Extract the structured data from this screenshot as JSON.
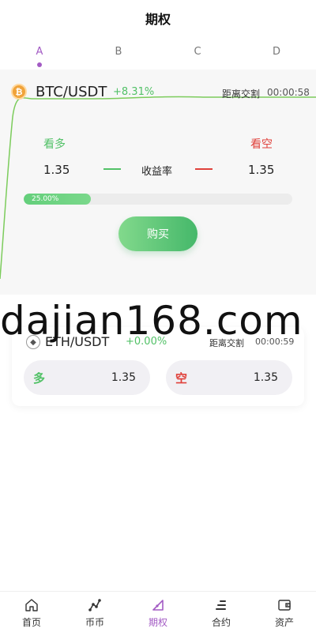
{
  "header": {
    "title": "期权"
  },
  "tabs": [
    {
      "label": "A",
      "active": true
    },
    {
      "label": "B",
      "active": false
    },
    {
      "label": "C",
      "active": false
    },
    {
      "label": "D",
      "active": false
    }
  ],
  "card1": {
    "icon": "bitcoin-icon",
    "pair": "BTC/USDT",
    "change": "+8.31%",
    "delivery_label": "距离交割",
    "delivery_time": "00:00:58",
    "long_label": "看多",
    "short_label": "看空",
    "long_value": "1.35",
    "short_value": "1.35",
    "rate_label": "收益率",
    "progress_text": "25.00%",
    "progress": 0.25,
    "buy_label": "购买"
  },
  "watermark": "dajian168.com",
  "card2": {
    "icon": "ethereum-icon",
    "pair": "ETH/USDT",
    "change": "+0.00%",
    "delivery_label": "距离交割",
    "delivery_time": "00:00:59",
    "long_key": "多",
    "long_value": "1.35",
    "short_key": "空",
    "short_value": "1.35"
  },
  "tabbar": [
    {
      "label": "首页",
      "icon": "home-icon",
      "active": false
    },
    {
      "label": "币币",
      "icon": "coin-exchange-icon",
      "active": false
    },
    {
      "label": "期权",
      "icon": "options-icon",
      "active": true
    },
    {
      "label": "合约",
      "icon": "contract-icon",
      "active": false
    },
    {
      "label": "资产",
      "icon": "wallet-icon",
      "active": false
    }
  ],
  "colors": {
    "accent": "#a35bc4",
    "up": "#52c167",
    "down": "#e0413b"
  }
}
